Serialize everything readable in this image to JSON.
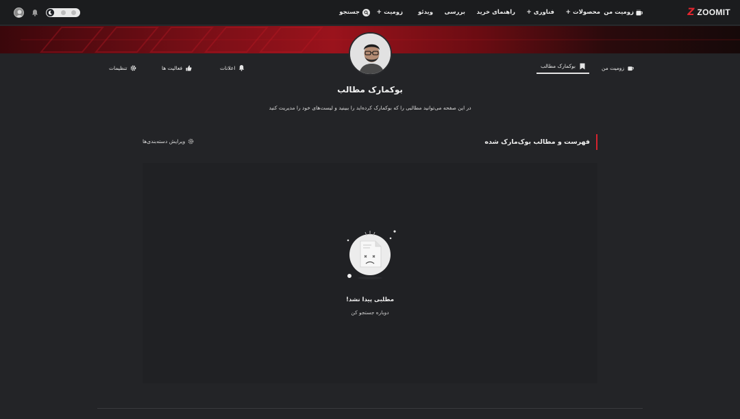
{
  "brand": {
    "name": "ZOOMIT",
    "accent": "#e4262f"
  },
  "nav": {
    "my_zoomit": "زومیت من",
    "products": "محصولات",
    "technology": "فناوری",
    "buying_guide": "راهنمای خرید",
    "review": "بررسی",
    "video": "ویدئو",
    "zoomit": "زومیت",
    "search": "جستجو",
    "plus": "+"
  },
  "profile": {
    "tabs": {
      "my_zoomit": "زومیت من",
      "bookmarks": "بوکمارک مطالب",
      "notifications": "اعلانات",
      "activities": "فعالیت ها",
      "settings": "تنظیمات"
    }
  },
  "page": {
    "title": "بوکمارک مطالب",
    "description": "در این صفحه می‌توانید مطالبی را که بوکمارک کرده‌اید را ببینید و لیست‌های خود را مدیریت کنید"
  },
  "section": {
    "heading": "فهرست و مطالب بوک‌مارک شده",
    "edit_categories": "ویرایش دسته‌بندی‌ها"
  },
  "empty_state": {
    "title": "مطلبی پیدا نشد!",
    "subtitle": "دوباره جستجو کن"
  },
  "icons": [
    "mug-icon",
    "search-icon",
    "bell-icon",
    "moon-icon",
    "bookmark-icon",
    "like-icon",
    "gear-icon",
    "sad-document-icon"
  ]
}
